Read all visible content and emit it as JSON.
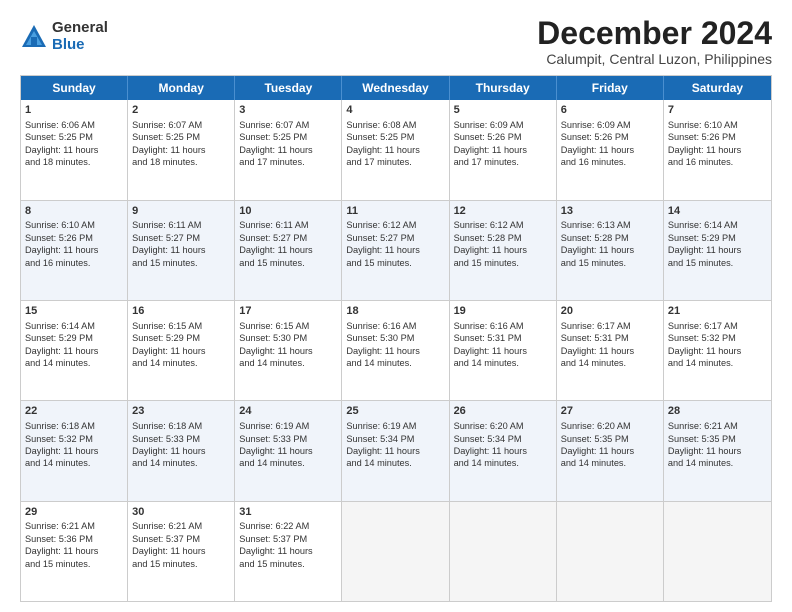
{
  "logo": {
    "general": "General",
    "blue": "Blue"
  },
  "title": "December 2024",
  "subtitle": "Calumpit, Central Luzon, Philippines",
  "days": [
    "Sunday",
    "Monday",
    "Tuesday",
    "Wednesday",
    "Thursday",
    "Friday",
    "Saturday"
  ],
  "weeks": [
    [
      {
        "num": "1",
        "lines": [
          "Sunrise: 6:06 AM",
          "Sunset: 5:25 PM",
          "Daylight: 11 hours",
          "and 18 minutes."
        ]
      },
      {
        "num": "2",
        "lines": [
          "Sunrise: 6:07 AM",
          "Sunset: 5:25 PM",
          "Daylight: 11 hours",
          "and 18 minutes."
        ]
      },
      {
        "num": "3",
        "lines": [
          "Sunrise: 6:07 AM",
          "Sunset: 5:25 PM",
          "Daylight: 11 hours",
          "and 17 minutes."
        ]
      },
      {
        "num": "4",
        "lines": [
          "Sunrise: 6:08 AM",
          "Sunset: 5:25 PM",
          "Daylight: 11 hours",
          "and 17 minutes."
        ]
      },
      {
        "num": "5",
        "lines": [
          "Sunrise: 6:09 AM",
          "Sunset: 5:26 PM",
          "Daylight: 11 hours",
          "and 17 minutes."
        ]
      },
      {
        "num": "6",
        "lines": [
          "Sunrise: 6:09 AM",
          "Sunset: 5:26 PM",
          "Daylight: 11 hours",
          "and 16 minutes."
        ]
      },
      {
        "num": "7",
        "lines": [
          "Sunrise: 6:10 AM",
          "Sunset: 5:26 PM",
          "Daylight: 11 hours",
          "and 16 minutes."
        ]
      }
    ],
    [
      {
        "num": "8",
        "lines": [
          "Sunrise: 6:10 AM",
          "Sunset: 5:26 PM",
          "Daylight: 11 hours",
          "and 16 minutes."
        ]
      },
      {
        "num": "9",
        "lines": [
          "Sunrise: 6:11 AM",
          "Sunset: 5:27 PM",
          "Daylight: 11 hours",
          "and 15 minutes."
        ]
      },
      {
        "num": "10",
        "lines": [
          "Sunrise: 6:11 AM",
          "Sunset: 5:27 PM",
          "Daylight: 11 hours",
          "and 15 minutes."
        ]
      },
      {
        "num": "11",
        "lines": [
          "Sunrise: 6:12 AM",
          "Sunset: 5:27 PM",
          "Daylight: 11 hours",
          "and 15 minutes."
        ]
      },
      {
        "num": "12",
        "lines": [
          "Sunrise: 6:12 AM",
          "Sunset: 5:28 PM",
          "Daylight: 11 hours",
          "and 15 minutes."
        ]
      },
      {
        "num": "13",
        "lines": [
          "Sunrise: 6:13 AM",
          "Sunset: 5:28 PM",
          "Daylight: 11 hours",
          "and 15 minutes."
        ]
      },
      {
        "num": "14",
        "lines": [
          "Sunrise: 6:14 AM",
          "Sunset: 5:29 PM",
          "Daylight: 11 hours",
          "and 15 minutes."
        ]
      }
    ],
    [
      {
        "num": "15",
        "lines": [
          "Sunrise: 6:14 AM",
          "Sunset: 5:29 PM",
          "Daylight: 11 hours",
          "and 14 minutes."
        ]
      },
      {
        "num": "16",
        "lines": [
          "Sunrise: 6:15 AM",
          "Sunset: 5:29 PM",
          "Daylight: 11 hours",
          "and 14 minutes."
        ]
      },
      {
        "num": "17",
        "lines": [
          "Sunrise: 6:15 AM",
          "Sunset: 5:30 PM",
          "Daylight: 11 hours",
          "and 14 minutes."
        ]
      },
      {
        "num": "18",
        "lines": [
          "Sunrise: 6:16 AM",
          "Sunset: 5:30 PM",
          "Daylight: 11 hours",
          "and 14 minutes."
        ]
      },
      {
        "num": "19",
        "lines": [
          "Sunrise: 6:16 AM",
          "Sunset: 5:31 PM",
          "Daylight: 11 hours",
          "and 14 minutes."
        ]
      },
      {
        "num": "20",
        "lines": [
          "Sunrise: 6:17 AM",
          "Sunset: 5:31 PM",
          "Daylight: 11 hours",
          "and 14 minutes."
        ]
      },
      {
        "num": "21",
        "lines": [
          "Sunrise: 6:17 AM",
          "Sunset: 5:32 PM",
          "Daylight: 11 hours",
          "and 14 minutes."
        ]
      }
    ],
    [
      {
        "num": "22",
        "lines": [
          "Sunrise: 6:18 AM",
          "Sunset: 5:32 PM",
          "Daylight: 11 hours",
          "and 14 minutes."
        ]
      },
      {
        "num": "23",
        "lines": [
          "Sunrise: 6:18 AM",
          "Sunset: 5:33 PM",
          "Daylight: 11 hours",
          "and 14 minutes."
        ]
      },
      {
        "num": "24",
        "lines": [
          "Sunrise: 6:19 AM",
          "Sunset: 5:33 PM",
          "Daylight: 11 hours",
          "and 14 minutes."
        ]
      },
      {
        "num": "25",
        "lines": [
          "Sunrise: 6:19 AM",
          "Sunset: 5:34 PM",
          "Daylight: 11 hours",
          "and 14 minutes."
        ]
      },
      {
        "num": "26",
        "lines": [
          "Sunrise: 6:20 AM",
          "Sunset: 5:34 PM",
          "Daylight: 11 hours",
          "and 14 minutes."
        ]
      },
      {
        "num": "27",
        "lines": [
          "Sunrise: 6:20 AM",
          "Sunset: 5:35 PM",
          "Daylight: 11 hours",
          "and 14 minutes."
        ]
      },
      {
        "num": "28",
        "lines": [
          "Sunrise: 6:21 AM",
          "Sunset: 5:35 PM",
          "Daylight: 11 hours",
          "and 14 minutes."
        ]
      }
    ],
    [
      {
        "num": "29",
        "lines": [
          "Sunrise: 6:21 AM",
          "Sunset: 5:36 PM",
          "Daylight: 11 hours",
          "and 15 minutes."
        ]
      },
      {
        "num": "30",
        "lines": [
          "Sunrise: 6:21 AM",
          "Sunset: 5:37 PM",
          "Daylight: 11 hours",
          "and 15 minutes."
        ]
      },
      {
        "num": "31",
        "lines": [
          "Sunrise: 6:22 AM",
          "Sunset: 5:37 PM",
          "Daylight: 11 hours",
          "and 15 minutes."
        ]
      },
      null,
      null,
      null,
      null
    ]
  ]
}
